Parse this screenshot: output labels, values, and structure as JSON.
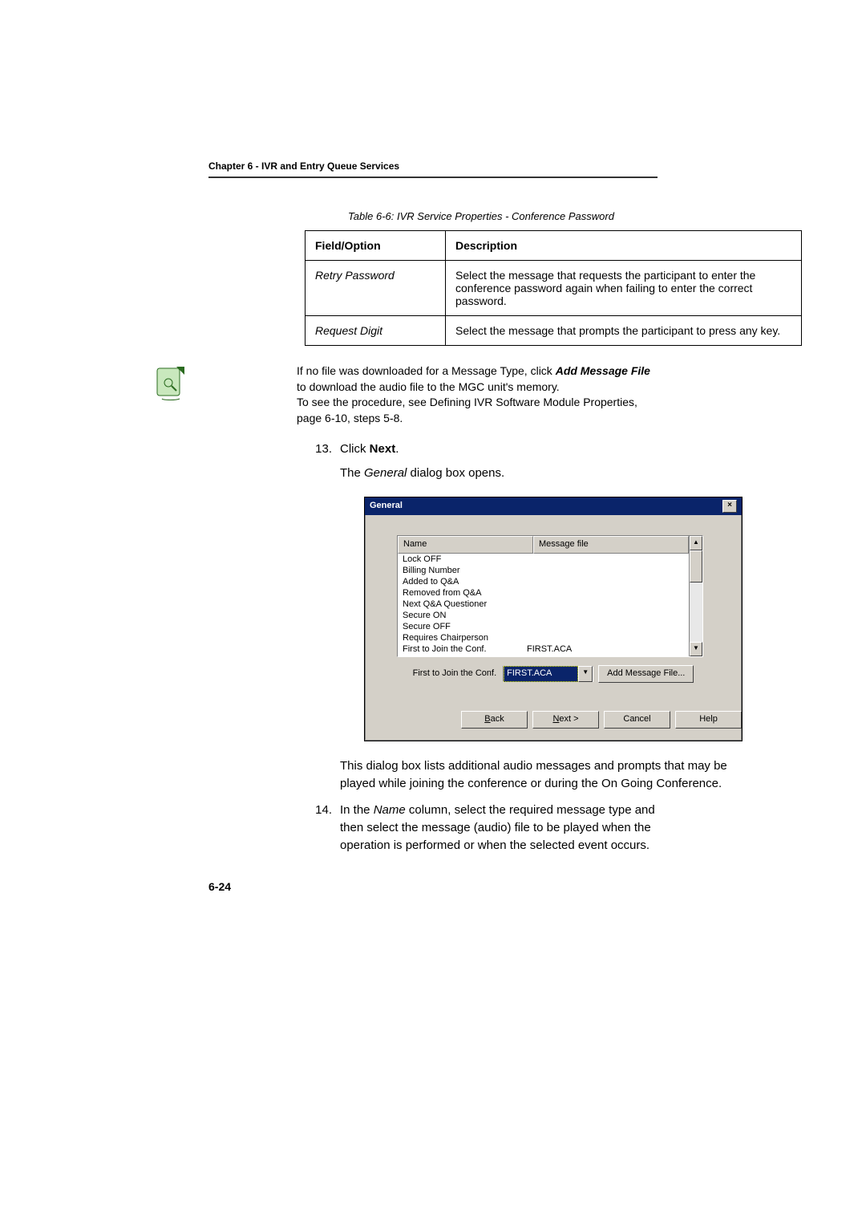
{
  "chapter_header": "Chapter 6 - IVR and Entry Queue Services",
  "table_caption": "Table 6-6: IVR Service Properties - Conference Password",
  "table": {
    "head": {
      "field": "Field/Option",
      "desc": "Description"
    },
    "rows": [
      {
        "field": "Retry Password",
        "desc": "Select the message that requests the participant to enter the conference password again when failing to enter the correct password."
      },
      {
        "field": "Request Digit",
        "desc": "Select the message that prompts the participant to press any key."
      }
    ]
  },
  "note": {
    "line1_pre": "If no file was downloaded for a Message Type, click ",
    "line1_bold": "Add Message File",
    "line1_post": " to download the audio file to the MGC unit's memory.",
    "line2": "To see the procedure, see Defining IVR Software Module Properties, page 6-10, steps 5-8."
  },
  "step13": {
    "num": "13.",
    "pre": "Click ",
    "bold": "Next",
    "post": ".",
    "after": "The ",
    "after_it": "General",
    "after_post": " dialog box opens."
  },
  "dialog": {
    "title": "General",
    "close": "×",
    "headers": {
      "name": "Name",
      "msg": "Message file"
    },
    "rows": [
      {
        "name": "Lock OFF",
        "msg": ""
      },
      {
        "name": "Billing Number",
        "msg": ""
      },
      {
        "name": "Added to Q&A",
        "msg": ""
      },
      {
        "name": "Removed from Q&A",
        "msg": ""
      },
      {
        "name": "Next Q&A Questioner",
        "msg": ""
      },
      {
        "name": "Secure ON",
        "msg": ""
      },
      {
        "name": "Secure OFF",
        "msg": ""
      },
      {
        "name": "Requires Chairperson",
        "msg": ""
      },
      {
        "name": "First to Join the Conf.",
        "msg": "FIRST.ACA"
      }
    ],
    "label": "First to Join the Conf.",
    "combo_value": "FIRST.ACA",
    "add_btn": "Add Message File...",
    "scroll": {
      "up": "▲",
      "down": "▼"
    },
    "buttons": {
      "back": "< Back",
      "next": "Next >",
      "cancel": "Cancel",
      "help": "Help"
    }
  },
  "para_after_dialog": "This dialog box lists additional audio messages and prompts that may be played while joining the conference or during the On Going Conference.",
  "step14": {
    "num": "14.",
    "pre": "In the ",
    "it": "Name",
    "post": " column, select the required message type and then select the message (audio) file to be played when the operation is performed or when the selected event occurs."
  },
  "page_number": "6-24"
}
